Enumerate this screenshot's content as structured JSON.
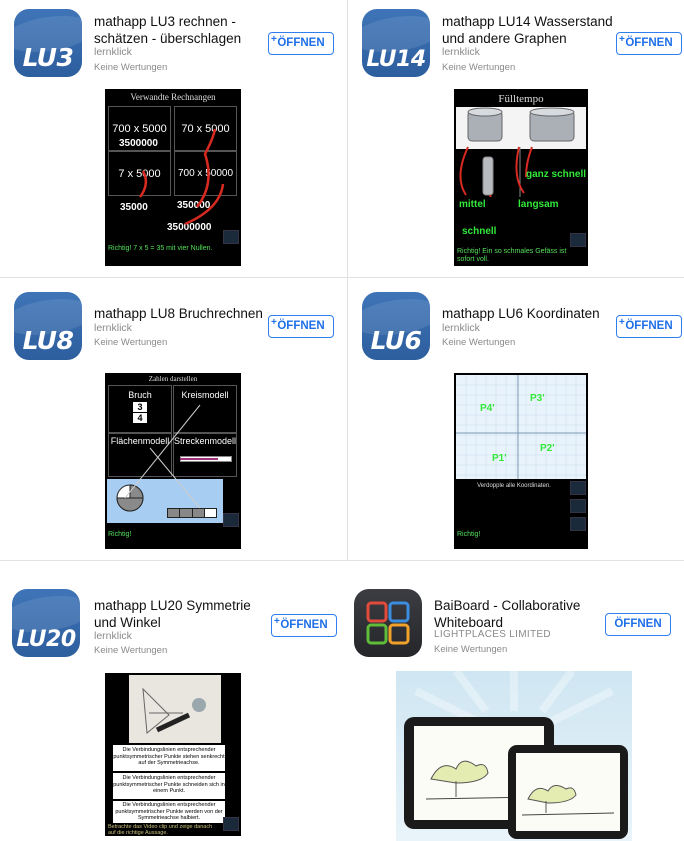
{
  "apps": [
    {
      "icon_text": "LU3",
      "icon_name": "lu3-app-icon",
      "title_line1": "mathapp LU3 rechnen -",
      "title_line2": "schätzen - überschlagen",
      "developer": "lernklick",
      "rating": "Keine Wertungen",
      "button": "ÖFFNEN",
      "button_plus": "+",
      "shot": {
        "header": "Verwandte Rechnangen",
        "tiles": [
          "700 x 5000",
          "70 x 5000",
          "7 x 5000",
          "700 x 50000"
        ],
        "results": [
          "3500000",
          "35000",
          "350000",
          "35000000"
        ],
        "feedback": "Richtig! 7 x 5 = 35 mit vier Nullen."
      }
    },
    {
      "icon_text": "LU14",
      "icon_name": "lu14-app-icon",
      "title_line1": "mathapp LU14 Wasserstand",
      "title_line2": "und andere Graphen",
      "developer": "lernklick",
      "rating": "Keine Wertungen",
      "button": "ÖFFNEN",
      "button_plus": "+",
      "shot": {
        "header": "Fülltempo",
        "labels": [
          "ganz schnell",
          "mittel",
          "langsam",
          "schnell"
        ],
        "feedback": "Richtig! Ein so schmales Gefäss ist sofort voll."
      }
    },
    {
      "icon_text": "LU8",
      "icon_name": "lu8-app-icon",
      "title_line1": "mathapp LU8 Bruchrechnen",
      "title_line2": "",
      "developer": "lernklick",
      "rating": "Keine Wertungen",
      "button": "ÖFFNEN",
      "button_plus": "+",
      "shot": {
        "header": "Zahlen darstellen",
        "tiles": [
          "Bruch",
          "Kreismodell",
          "Flächenmodell",
          "Streckenmodell"
        ],
        "fraction_num": "3",
        "fraction_den": "4",
        "feedback": "Richtig!"
      }
    },
    {
      "icon_text": "LU6",
      "icon_name": "lu6-app-icon",
      "title_line1": "mathapp LU6 Koordinaten",
      "title_line2": "",
      "developer": "lernklick",
      "rating": "Keine Wertungen",
      "button": "ÖFFNEN",
      "button_plus": "+",
      "shot": {
        "points": [
          "P4'",
          "P3'",
          "P2'",
          "P1'"
        ],
        "caption": "Verdopple alle Koordinaten.",
        "feedback": "Richtig!"
      }
    },
    {
      "icon_text": "LU20",
      "icon_name": "lu20-app-icon",
      "title_line1": "mathapp LU20 Symmetrie",
      "title_line2": "und Winkel",
      "developer": "lernklick",
      "rating": "Keine Wertungen",
      "button": "ÖFFNEN",
      "button_plus": "+",
      "shot": {
        "statements": [
          "Die Verbindungslinien entsprechender punktsymmetrischer Punkte stehen senkrecht auf der Symmetrieachse.",
          "Die Verbindungslinien entsprechender punktsymmetrischer Punkte schneiden sich in einem Punkt.",
          "Die Verbindungslinien entsprechender punktsymmetrischer Punkte werden von der Symmetrieachse halbiert."
        ],
        "footer": "Betrachte das Video clip und zeige danach auf die richtige Aussage."
      }
    },
    {
      "icon_text": "",
      "icon_name": "puzzle-app-icon",
      "title_line1": "BaiBoard - Collaborative",
      "title_line2": "Whiteboard",
      "developer": "LIGHTPLACES LIMITED",
      "rating": "Keine Wertungen",
      "button": "ÖFFNEN",
      "button_plus": ""
    }
  ],
  "colors": {
    "icon_blue": "#3a6fb2",
    "button_blue": "#1e6fe8",
    "answer_green": "#33e83a",
    "arrow_red": "#d82a20"
  }
}
